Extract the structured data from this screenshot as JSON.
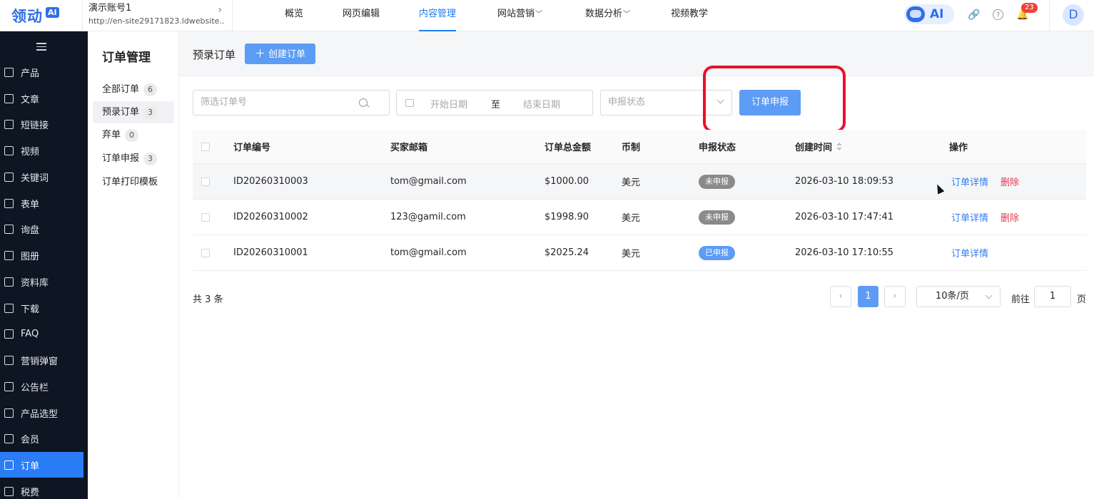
{
  "header": {
    "logo_text": "领动",
    "logo_badge": "AI",
    "site_name": "演示账号1",
    "site_url": "http://en-site29171823.ldwebsite....",
    "nav": [
      {
        "label": "概览",
        "active": false,
        "dropdown": false
      },
      {
        "label": "网页编辑",
        "active": false,
        "dropdown": false
      },
      {
        "label": "内容管理",
        "active": true,
        "dropdown": false
      },
      {
        "label": "网站营销",
        "active": false,
        "dropdown": true
      },
      {
        "label": "数据分析",
        "active": false,
        "dropdown": true
      },
      {
        "label": "视频教学",
        "active": false,
        "dropdown": false
      }
    ],
    "ai_label": "AI",
    "notification_count": "23",
    "avatar_letter": "D",
    "accent_color": "#1f7cf5"
  },
  "sidebar": {
    "items": [
      {
        "label": "产品",
        "icon": "grid-icon"
      },
      {
        "label": "文章",
        "icon": "document-icon"
      },
      {
        "label": "短链接",
        "icon": "link-icon"
      },
      {
        "label": "视频",
        "icon": "video-icon"
      },
      {
        "label": "关键词",
        "icon": "keyword-icon"
      },
      {
        "label": "表单",
        "icon": "form-icon"
      },
      {
        "label": "询盘",
        "icon": "inquiry-icon"
      },
      {
        "label": "图册",
        "icon": "gallery-icon"
      },
      {
        "label": "资料库",
        "icon": "library-icon"
      },
      {
        "label": "下载",
        "icon": "download-icon"
      },
      {
        "label": "FAQ",
        "icon": "faq-icon"
      },
      {
        "label": "营销弹窗",
        "icon": "popup-icon"
      },
      {
        "label": "公告栏",
        "icon": "bulletin-icon"
      },
      {
        "label": "产品选型",
        "icon": "cube-icon"
      },
      {
        "label": "会员",
        "icon": "member-icon"
      },
      {
        "label": "订单",
        "icon": "order-icon",
        "active": true
      },
      {
        "label": "税费",
        "icon": "tax-icon"
      }
    ]
  },
  "subsidebar": {
    "title": "订单管理",
    "items": [
      {
        "label": "全部订单",
        "count": "6"
      },
      {
        "label": "预录订单",
        "count": "3",
        "active": true
      },
      {
        "label": "弃单",
        "count": "0"
      },
      {
        "label": "订单申报",
        "count": "3"
      },
      {
        "label": "订单打印模板",
        "count": null
      }
    ]
  },
  "main": {
    "page_title": "预录订单",
    "create_button": "创建订单",
    "filters": {
      "search_placeholder": "筛选订单号",
      "start_date_placeholder": "开始日期",
      "range_separator": "至",
      "end_date_placeholder": "结束日期",
      "status_placeholder": "申报状态",
      "report_button": "订单申报"
    },
    "table": {
      "columns": [
        "订单编号",
        "买家邮箱",
        "订单总金额",
        "币制",
        "申报状态",
        "创建时间",
        "操作"
      ],
      "rows": [
        {
          "id": "ID20260310003",
          "email": "tom@gmail.com",
          "amount": "$1000.00",
          "currency": "美元",
          "status": "未申报",
          "status_color": "#8a8a8a",
          "created": "2026-03-10 18:09:53",
          "detail": "订单详情",
          "delete": "删除"
        },
        {
          "id": "ID20260310002",
          "email": "123@gamil.com",
          "amount": "$1998.90",
          "currency": "美元",
          "status": "未申报",
          "status_color": "#8a8a8a",
          "created": "2026-03-10 17:47:41",
          "detail": "订单详情",
          "delete": "删除"
        },
        {
          "id": "ID20260310001",
          "email": "tom@gmail.com",
          "amount": "$2025.24",
          "currency": "美元",
          "status": "已申报",
          "status_color": "#5d9cf5",
          "created": "2026-03-10 17:10:55",
          "detail": "订单详情",
          "delete": ""
        }
      ]
    },
    "pagination": {
      "total": "共 3 条",
      "current_page": "1",
      "page_size": "10条/页",
      "goto_label": "前往",
      "goto_value": "1",
      "goto_suffix": "页"
    }
  }
}
